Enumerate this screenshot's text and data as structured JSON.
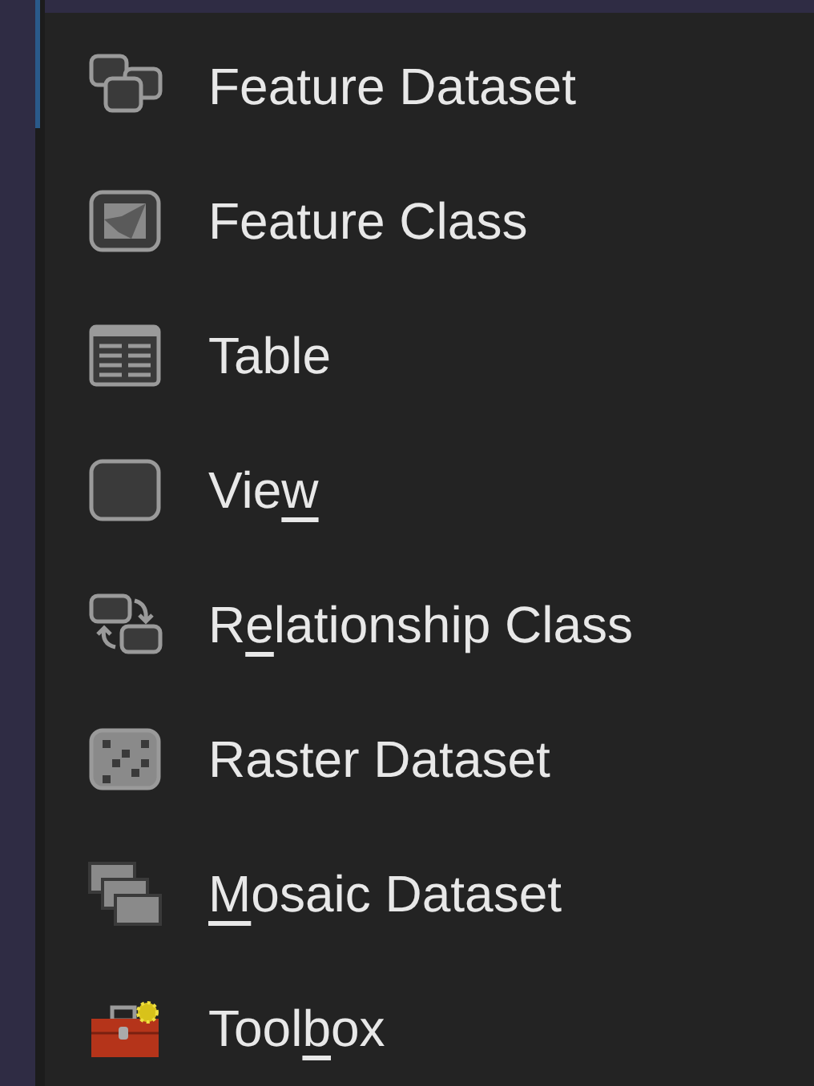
{
  "menu": {
    "items": [
      {
        "label": "Feature Dataset"
      },
      {
        "label": "Feature Class"
      },
      {
        "label": "Table"
      },
      {
        "before": "Vie",
        "key": "w"
      },
      {
        "before": "R",
        "key": "e",
        "after": "lationship Class"
      },
      {
        "label": "Raster Dataset"
      },
      {
        "key": "M",
        "after": "osaic Dataset"
      },
      {
        "before": "Tool",
        "key": "b",
        "after": "ox"
      }
    ]
  }
}
